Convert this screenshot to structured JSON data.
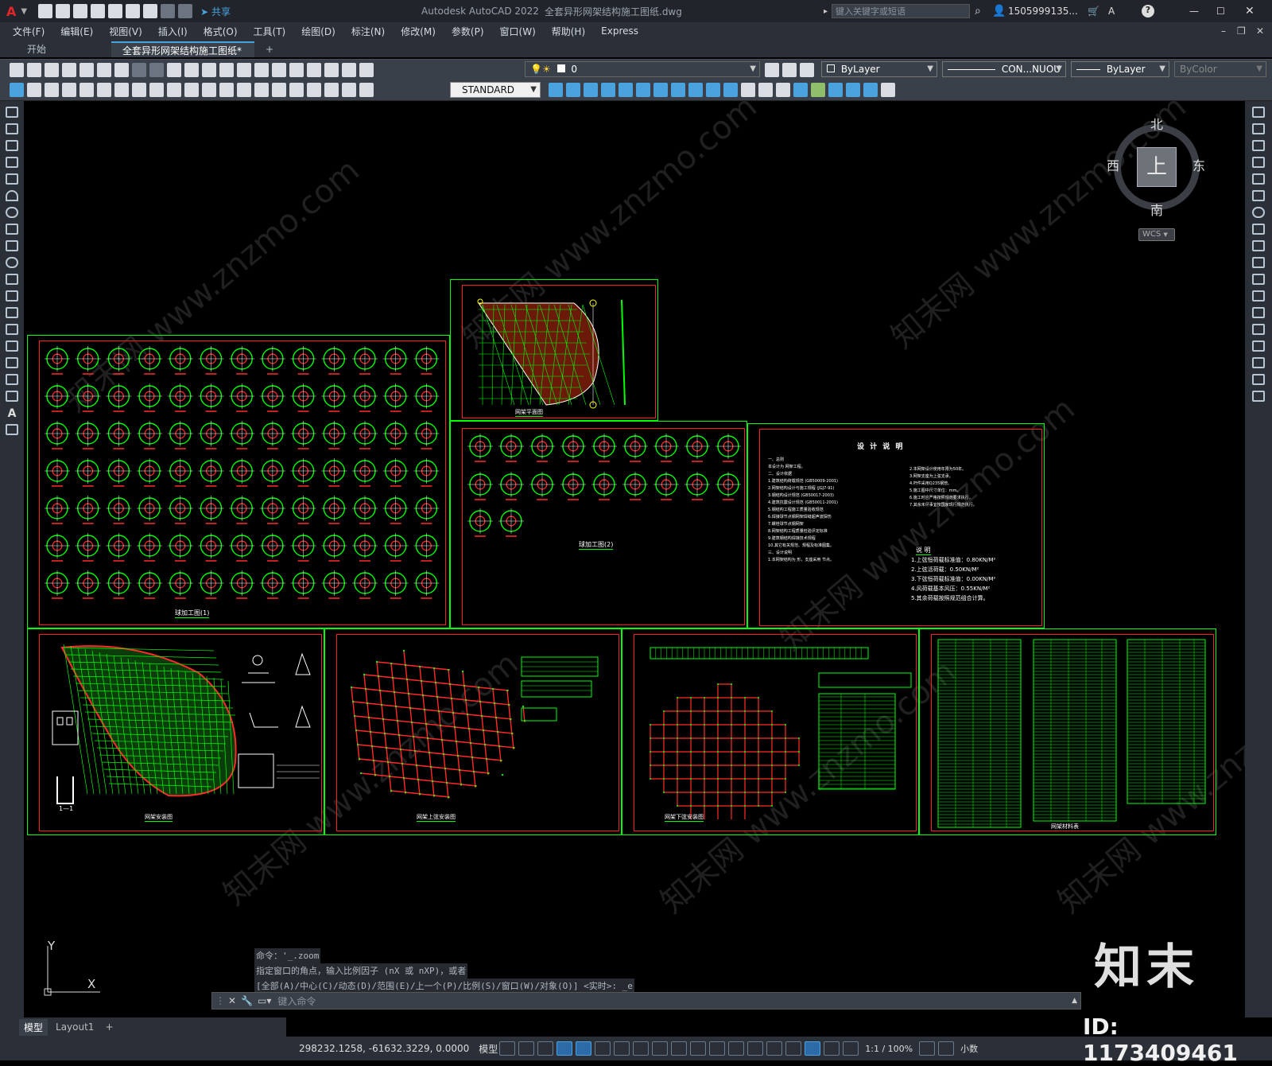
{
  "titlebar": {
    "app_title": "Autodesk AutoCAD 2022",
    "doc_title": "全套异形网架结构施工图纸.dwg",
    "share": "共享",
    "search_placeholder": "键入关键字或短语",
    "user": "1505999135...",
    "help": "?"
  },
  "menu": [
    "文件(F)",
    "编辑(E)",
    "视图(V)",
    "插入(I)",
    "格式(O)",
    "工具(T)",
    "绘图(D)",
    "标注(N)",
    "修改(M)",
    "参数(P)",
    "窗口(W)",
    "帮助(H)",
    "Express"
  ],
  "tabs": {
    "start": "开始",
    "document": "全套异形网架结构施工图纸*",
    "add": "+"
  },
  "toolbar": {
    "layer_value": "0",
    "color": "ByLayer",
    "linetype": "CON...NUOU",
    "lineweight": "ByLayer",
    "plotstyle": "ByColor",
    "textstyle": "STANDARD"
  },
  "viewcube": {
    "north": "北",
    "south": "南",
    "east": "东",
    "west": "西",
    "top": "上",
    "wcs": "WCS"
  },
  "ucs": {
    "x": "X",
    "y": "Y"
  },
  "sheets": {
    "nodes1_title": "球加工图(1)",
    "plan_title": "网架平面图",
    "nodes2_title": "球加工图(2)",
    "design_title": "设 计 说 明",
    "layout_title": "网架安装图",
    "upper_title": "网架上弦安装图",
    "lower_title": "网架下弦安装图",
    "material_title": "网架材料表",
    "detail_label": "1—1"
  },
  "design_notes": {
    "left": [
      "一、总则",
      "本设计为 网架工程。",
      "二、设计依据",
      "1.建筑结构荷载规范 (GB50009-2001)",
      "2.网架结构设计与施工规程 (JGJ7-91)",
      "3.钢结构设计规范 (GB50017-2003)",
      "4.建筑抗震设计规范 (GB50011-2001)",
      "5.钢结构工程施工质量验收规范",
      "6.焊接球节点钢网架焊缝超声波探伤",
      "7.螺栓球节点钢网架",
      "8.网架结构工程质量检验评定标准",
      "9.建筑钢结构焊接技术规程",
      "10.其它有关规范、规程及标准图集。",
      "三、设计说明",
      "1.本网架结构为 形，支座采用 节点。"
    ],
    "right": [
      "2.本网架设计使用年限为50年。",
      "3.网架支座为上弦支承。",
      "4.杆件采用Q235钢管。",
      "5.施工图中尺寸单位：mm。",
      "6.施工时应严格按照规范要求执行。",
      "7.其余未尽事宜按国家现行规范执行。"
    ],
    "loads_title": "说 明",
    "loads": [
      "1.上弦恒荷载标准值：0.80KN/M²",
      "2.上弦活荷载：0.50KN/M²",
      "3.下弦恒荷载标准值：0.00KN/M²",
      "4.风荷载基本风压：0.55KN/M²",
      "5.其余荷载按照规范组合计算。"
    ]
  },
  "command": {
    "history1": "命令：'_.zoom",
    "history2": "指定窗口的角点，输入比例因子 (nX 或 nXP)，或者",
    "history3": "[全部(A)/中心(C)/动态(D)/范围(E)/上一个(P)/比例(S)/窗口(W)/对象(O)] <实时>: _e",
    "placeholder": "键入命令"
  },
  "layout_tabs": {
    "model": "模型",
    "layout1": "Layout1",
    "add": "+"
  },
  "status": {
    "coords": "298232.1258, -61632.3229, 0.0000",
    "mode": "模型",
    "scale": "1:1 / 100%",
    "units": "小数"
  },
  "watermark": {
    "logo": "知末",
    "id": "ID: 1173409461",
    "repeat": "知末网 www.znzmo.com"
  }
}
